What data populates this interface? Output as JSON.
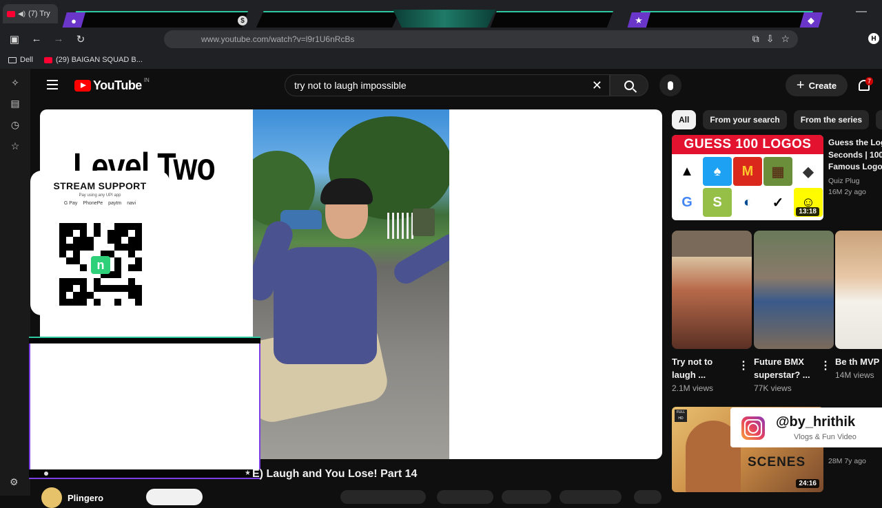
{
  "browser": {
    "tab_title": "(7) Try",
    "url": "www.youtube.com/watch?v=l9r1U6nRcBs",
    "bookmarks": [
      "Dell",
      "(29) BAIGAN SQUAD B..."
    ],
    "profile_initial": "H"
  },
  "youtube": {
    "logo_text": "YouTube",
    "region": "IN",
    "search_query": "try not to laugh impossible",
    "create_label": "Create",
    "notification_count": "7"
  },
  "video": {
    "overlay_text": "Level Two",
    "title_visible": "E) Laugh and You Lose! Part 14",
    "channel": "Plingero"
  },
  "support_card": {
    "title": "STREAM SUPPORT",
    "subtitle": "Pay using any UPI app",
    "apps": [
      "G Pay",
      "PhonePe",
      "paytm",
      "navi"
    ]
  },
  "chips": [
    "All",
    "From your search",
    "From the series",
    "Fr"
  ],
  "featured": {
    "banner": "GUESS 100 LOGOS",
    "title_lines": [
      "Guess the Log",
      "Seconds | 100",
      "Famous Logos"
    ],
    "channel": "Quiz Plug",
    "meta": "16M  2y ago",
    "duration": "13:18"
  },
  "shorts": [
    {
      "title": "Try not to laugh ...",
      "views": "2.1M views"
    },
    {
      "title": "Future BMX superstar? ...",
      "views": "77K views"
    },
    {
      "title": "Be th MVP in you",
      "views": "14M views"
    }
  ],
  "comedy": {
    "word": "SCENES",
    "duration": "24:16",
    "meta": "28M  7y ago"
  },
  "instagram": {
    "handle": "@by_hrithik",
    "tagline": "Vlogs & Fun Video"
  },
  "colors": {
    "accent_teal": "#2ec9a0",
    "accent_purple": "#7b3fe4",
    "youtube_red": "#ff0000"
  }
}
